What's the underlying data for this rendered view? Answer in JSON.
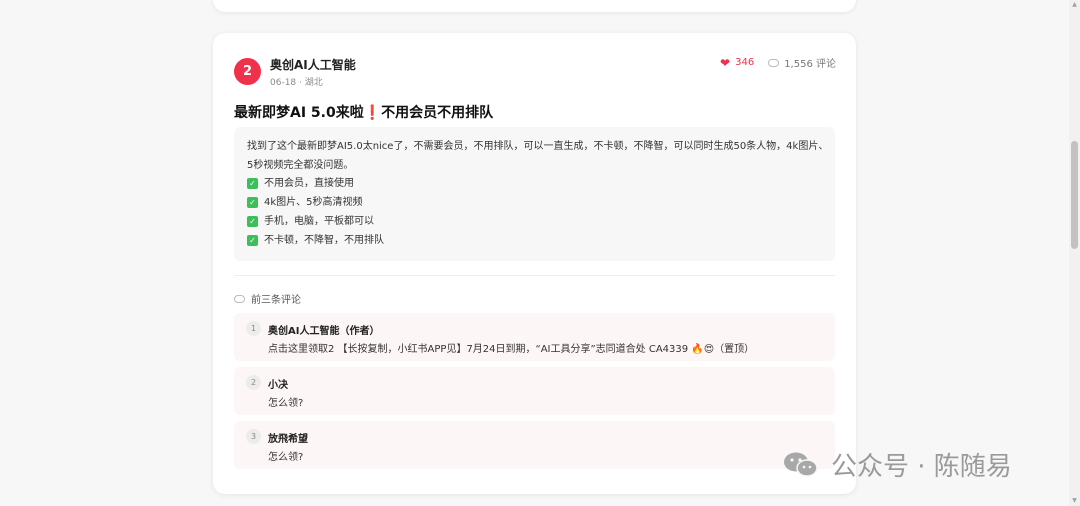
{
  "post": {
    "rank": "2",
    "author": "奥创AI人工智能",
    "meta": "06-18 · 湖北",
    "likes": "346",
    "comments_count": "1,556 评论",
    "title_main": "最新即梦AI 5.0来啦",
    "title_bang": "❗",
    "title_tail": "不用会员不用排队",
    "content_paragraph": "找到了这个最新即梦AI5.0太nice了，不需要会员，不用排队，可以一直生成，不卡顿，不降智，可以同时生成50条人物，4k图片、5秒视频完全都没问题。",
    "checklist": [
      "不用会员，直接使用",
      "4k图片、5秒高清视频",
      "手机，电脑，平板都可以",
      "不卡顿，不降智，不用排队"
    ],
    "top_comments_label": "前三条评论",
    "top_comments": [
      {
        "num": "1",
        "name": "奥创AI人工智能（作者）",
        "text": "点击这里领取2 【长按复制，小红书APP见】7月24日到期，“AI工具分享”志同道合处 CA4339 🔥😍（置顶）"
      },
      {
        "num": "2",
        "name": "小决",
        "text": "怎么领?"
      },
      {
        "num": "3",
        "name": "放飛希望",
        "text": "怎么领?"
      }
    ]
  },
  "watermark": "公众号 · 陈随易",
  "icons": {
    "like": "heart-icon",
    "comment": "comment-bubble-icon",
    "check": "check-box-icon",
    "wechat": "wechat-icon"
  },
  "colors": {
    "accent": "#f0314b",
    "check": "#3cbf5a"
  }
}
